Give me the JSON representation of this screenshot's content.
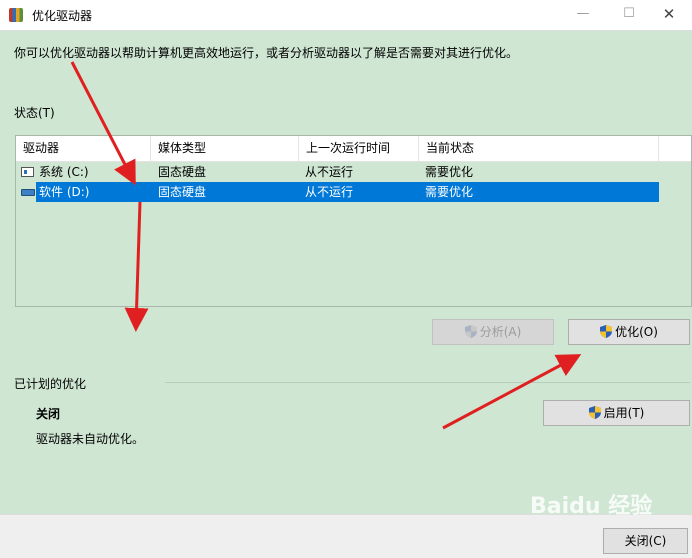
{
  "window": {
    "title": "优化驱动器",
    "minimize_glyph": "—",
    "maximize_glyph": "☐",
    "close_glyph": "✕"
  },
  "intro_text": "你可以优化驱动器以帮助计算机更高效地运行，或者分析驱动器以了解是否需要对其进行优化。",
  "status_section": {
    "label": "状态(T)",
    "columns": [
      "驱动器",
      "媒体类型",
      "上一次运行时间",
      "当前状态"
    ],
    "rows": [
      {
        "drive": "系统 (C:)",
        "media": "固态硬盘",
        "last_run": "从不运行",
        "status": "需要优化",
        "icon": "system-drive-icon",
        "selected": false
      },
      {
        "drive": "软件 (D:)",
        "media": "固态硬盘",
        "last_run": "从不运行",
        "status": "需要优化",
        "icon": "drive-icon",
        "selected": true
      }
    ]
  },
  "buttons": {
    "analyze": "分析(A)",
    "optimize": "优化(O)",
    "enable": "启用(T)",
    "close": "关闭(C)"
  },
  "scheduled": {
    "label": "已计划的优化",
    "status": "关闭",
    "description": "驱动器未自动优化。"
  },
  "watermark": "Baidu 经验",
  "colors": {
    "background": "#cfe6d3",
    "selection": "#0078d7",
    "annotation_arrow": "#e02020"
  }
}
